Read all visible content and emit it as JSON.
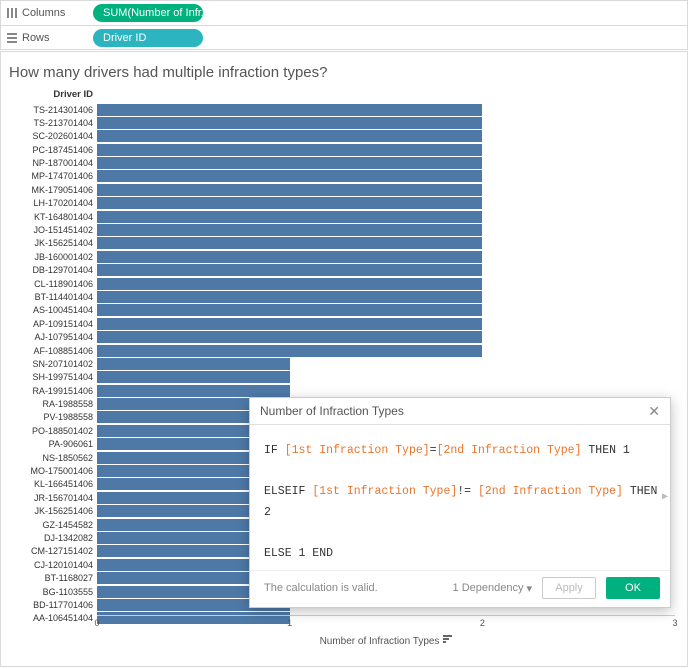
{
  "shelves": {
    "columns_label": "Columns",
    "rows_label": "Rows",
    "columns_pill": "SUM(Number of Infr..",
    "rows_pill": "Driver ID"
  },
  "viz_title": "How many drivers had multiple infraction types?",
  "axis": {
    "row_header": "Driver ID",
    "x_title": "Number of Infraction Types",
    "ticks": [
      "0",
      "1",
      "2",
      "3"
    ],
    "xmax": 3
  },
  "chart_data": {
    "type": "bar",
    "orientation": "horizontal",
    "title": "How many drivers had multiple infraction types?",
    "xlabel": "Number of Infraction Types",
    "ylabel": "Driver ID",
    "xlim": [
      0,
      3
    ],
    "categories": [
      "TS-214301406",
      "TS-213701404",
      "SC-202601404",
      "PC-187451406",
      "NP-187001404",
      "MP-174701406",
      "MK-179051406",
      "LH-170201404",
      "KT-164801404",
      "JO-151451402",
      "JK-156251404",
      "JB-160001402",
      "DB-129701404",
      "CL-118901406",
      "BT-114401404",
      "AS-100451404",
      "AP-109151404",
      "AJ-107951404",
      "AF-108851406",
      "SN-207101402",
      "SH-199751404",
      "RA-199151406",
      "RA-1988558",
      "PV-1988558",
      "PO-188501402",
      "PA-906061",
      "NS-1850562",
      "MO-175001406",
      "KL-166451406",
      "JR-156701404",
      "JK-156251406",
      "GZ-1454582",
      "DJ-1342082",
      "CM-127151402",
      "CJ-120101404",
      "BT-1168027",
      "BG-1103555",
      "BD-117701406",
      "AA-106451404"
    ],
    "values": [
      2,
      2,
      2,
      2,
      2,
      2,
      2,
      2,
      2,
      2,
      2,
      2,
      2,
      2,
      2,
      2,
      2,
      2,
      2,
      1,
      1,
      1,
      1,
      1,
      1,
      1,
      1,
      1,
      1,
      1,
      1,
      1,
      1,
      1,
      1,
      1,
      1,
      1,
      1
    ]
  },
  "dialog": {
    "title": "Number of Infraction Types",
    "code": {
      "l1_if": "IF",
      "l1_f1": "[1st Infraction Type]",
      "l1_eq": "=",
      "l1_f2": "[2nd Infraction Type]",
      "l1_then": "THEN",
      "l1_val": "1",
      "l2_elseif": "ELSEIF",
      "l2_f1": "[1st Infraction Type]",
      "l2_ne": "!=",
      "l2_f2": "[2nd Infraction Type]",
      "l2_then": "THEN",
      "l2_val": "2",
      "l3": "ELSE 1 END"
    },
    "status": "The calculation is valid.",
    "dependency": "1 Dependency",
    "apply": "Apply",
    "ok": "OK"
  }
}
